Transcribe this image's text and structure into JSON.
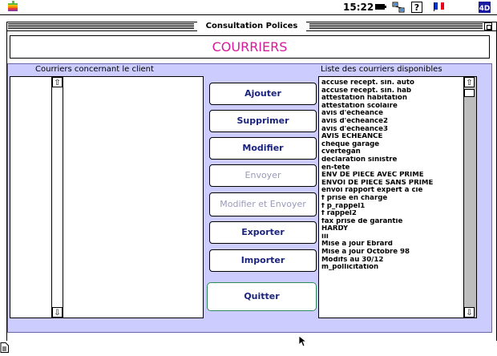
{
  "menubar": {
    "clock": "15:22",
    "status_icons": [
      "battery-icon",
      "network-icon",
      "help-icon",
      "flag-icon",
      "app-4d-icon"
    ],
    "flag_colors": [
      "#0033cc",
      "#ffffff",
      "#e8001c"
    ]
  },
  "window": {
    "title": "Consultation Polices"
  },
  "page": {
    "title": "COURRIERS",
    "title_color": "#d61a9a",
    "panel_color": "#ccccff"
  },
  "left_panel": {
    "label": "Courriers concernant le client",
    "items": []
  },
  "right_panel": {
    "label": "Liste des courriers disponibles",
    "items": [
      "accuse recept. sin. auto",
      "accuse recept. sin. hab",
      "attestation habitation",
      "attestation scolaire",
      "avis d'échéance",
      "avis d'echeance2",
      "avis d'echeance3",
      "AVIS ECHEANCE",
      "chèque garage",
      "cvertegan",
      "declaration sinistre",
      "en-tete",
      "ENV DE PIECE AVEC PRIME",
      "ENVOI DE PIECE SANS PRIME",
      "envoi rapport expert à cie",
      "f prise en charge",
      "f p_rappel1",
      "f rappel2",
      "fax prise de garantie",
      "HARDY",
      "iii",
      "Mise a jour Ebrard",
      "Mise a jour Octobre 98",
      "Modifs au 30/12",
      "m_pollicitation"
    ]
  },
  "buttons": {
    "add": "Ajouter",
    "delete": "Supprimer",
    "modify": "Modifier",
    "send": "Envoyer",
    "modify_send": "Modifier et Envoyer",
    "export": "Exporter",
    "import": "Importer",
    "quit": "Quitter"
  }
}
